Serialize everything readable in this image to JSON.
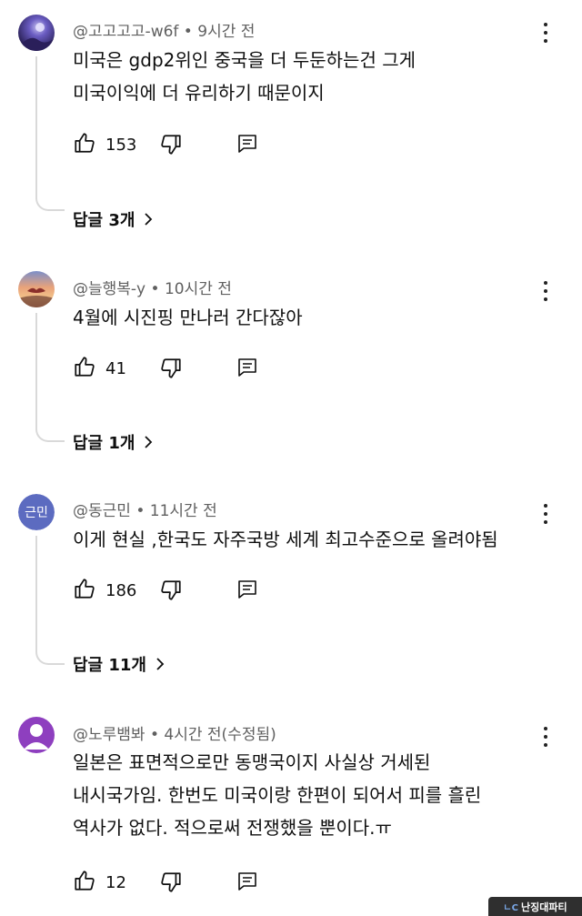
{
  "comments": [
    {
      "handle": "@고고고고-w6f",
      "time": "9시간 전",
      "lines": [
        "미국은 gdp2위인 중국을 더 두둔하는건  그게",
        "미국이익에 더 유리하기 때문이지"
      ],
      "likes": "153",
      "replies": "답글 3개"
    },
    {
      "handle": "@늘행복-y",
      "time": "10시간 전",
      "lines": [
        "4월에 시진핑 만나러 간다잖아"
      ],
      "likes": "41",
      "replies": "답글 1개"
    },
    {
      "handle": "@동근민",
      "time": "11시간 전",
      "avatar_initials": "근민",
      "lines": [
        "이게 현실 ,한국도 자주국방 세계 최고수준으로 올려야됨"
      ],
      "likes": "186",
      "replies": "답글 11개"
    },
    {
      "handle": "@노루뱀봐",
      "time": "4시간 전(수정됨)",
      "lines": [
        "일본은 표면적으로만 동맹국이지 사실상 거세된",
        "내시국가임. 한번도 미국이랑 한편이 되어서 피를 흘린",
        "역사가 없다. 적으로써 전쟁했을 뿐이다.ㅠ"
      ],
      "likes": "12"
    }
  ],
  "separator": " • ",
  "watermark": {
    "mark": "ㄴC",
    "text": "난징대파티"
  },
  "icons": {
    "like": "thumbs-up-icon",
    "dislike": "thumbs-down-icon",
    "reply": "reply-comment-icon",
    "more": "more-vert-icon",
    "chevron": "chevron-right-icon"
  },
  "colors": {
    "text": "#0f0f0f",
    "meta": "#606060",
    "thread_line": "#d9d9d9",
    "avatar_initials_bg": "#5c6bc0"
  }
}
